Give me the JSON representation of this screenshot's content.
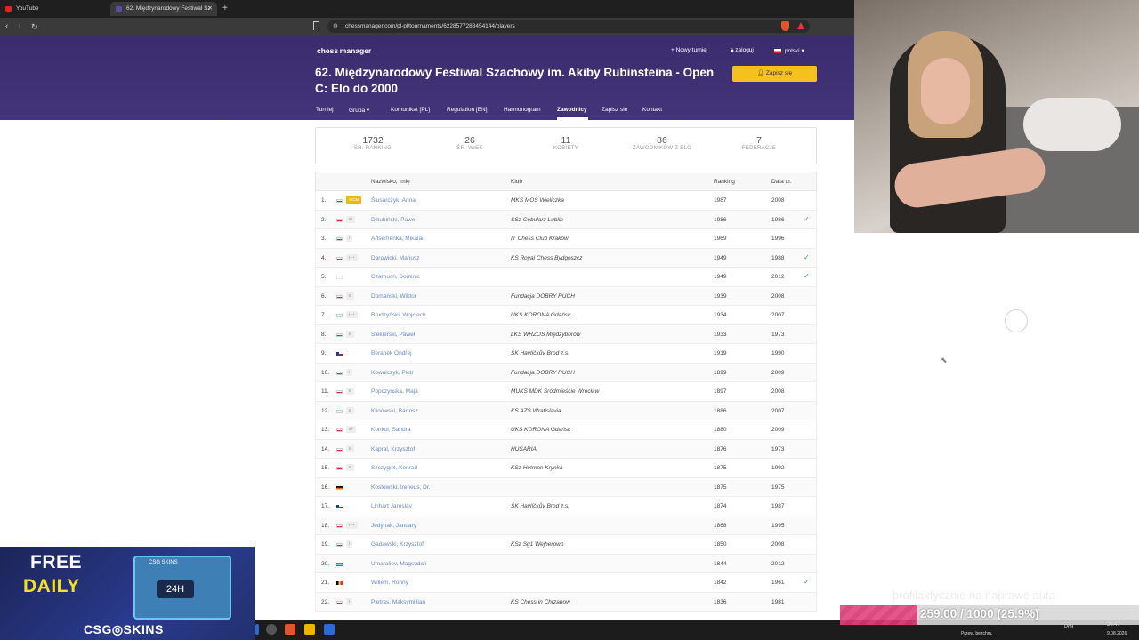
{
  "browser": {
    "tabs": [
      {
        "title": "YouTube",
        "active": false
      },
      {
        "title": "62. Międzynarodowy Festiwal Sz",
        "active": true
      }
    ],
    "url": "chessmanager.com/pl-pl/tournaments/6228577288454144/players"
  },
  "site": {
    "logo": "chess manager",
    "new_tournament": "+ Nowy turniej",
    "login": "zaloguj",
    "language": "polski",
    "title": "62. Międzynarodowy Festiwal Szachowy im. Akiby Rubinsteina - Open C: Elo do 2000",
    "join_button": "Zapisz się",
    "menu": [
      "Turniej",
      "Grupa",
      "Komunikat [PL]",
      "Regulation [EN]",
      "Harmonogram",
      "Zawodnicy",
      "Zapisz się",
      "Kontakt"
    ],
    "active_menu": "Zawodnicy"
  },
  "stats": [
    {
      "value": "1732",
      "label": "ŚR. RANKING"
    },
    {
      "value": "26",
      "label": "ŚR. WIEK"
    },
    {
      "value": "11",
      "label": "KOBIETY"
    },
    {
      "value": "86",
      "label": "ZAWODNIKÓW Z ELO"
    },
    {
      "value": "7",
      "label": "FEDERACJE"
    }
  ],
  "table": {
    "headers": {
      "name": "Nazwisko, Imię",
      "club": "Klub",
      "ranking": "Ranking",
      "year": "Data ur."
    },
    "rows": [
      {
        "no": "1.",
        "flag": "pl",
        "title": "WCM",
        "name": "Ślusarczyk, Anna",
        "club": "MKS MOS Wieliczka",
        "ranking": "1987",
        "year": "2008",
        "check": false
      },
      {
        "no": "2.",
        "flag": "pl",
        "title": "III",
        "name": "Dziubiński, Paweł",
        "club": "SSz Cebularz Lublin",
        "ranking": "1986",
        "year": "1986",
        "check": true
      },
      {
        "no": "3.",
        "flag": "pl",
        "title": "I",
        "name": "Artsemenka, Mikalai",
        "club": "IT Chess Club Kraków",
        "ranking": "1969",
        "year": "1996",
        "check": false
      },
      {
        "no": "4.",
        "flag": "pl",
        "title": "I++",
        "name": "Darowicki, Mariusz",
        "club": "KS Royal Chess Bydgoszcz",
        "ranking": "1949",
        "year": "1988",
        "check": true
      },
      {
        "no": "5.",
        "flag": "en",
        "title": "",
        "name": "Czarnuch, Dominic",
        "club": "",
        "ranking": "1949",
        "year": "2012",
        "check": true
      },
      {
        "no": "6.",
        "flag": "pl",
        "title": "II",
        "name": "Domański, Wiktor",
        "club": "Fundacja DOBRY RUCH",
        "ranking": "1939",
        "year": "2008",
        "check": false
      },
      {
        "no": "7.",
        "flag": "pl",
        "title": "I++",
        "name": "Brudzyński, Wojciech",
        "club": "UKS KORONA Gdańsk",
        "ranking": "1934",
        "year": "2007",
        "check": false
      },
      {
        "no": "8.",
        "flag": "pl",
        "title": "II",
        "name": "Siekierski, Paweł",
        "club": "LKS WRZOS Międzyborów",
        "ranking": "1933",
        "year": "1973",
        "check": false
      },
      {
        "no": "9.",
        "flag": "cz",
        "title": "",
        "name": "Beranek Ondřej",
        "club": "ŠK Havlíčkův Brod z.s.",
        "ranking": "1919",
        "year": "1990",
        "check": false
      },
      {
        "no": "10.",
        "flag": "pl",
        "title": "I",
        "name": "Kowalczyk, Piotr",
        "club": "Fundacja DOBRY RUCH",
        "ranking": "1899",
        "year": "2009",
        "check": false
      },
      {
        "no": "11.",
        "flag": "pl",
        "title": "II",
        "name": "Popczyńska, Maja",
        "club": "MUKS MDK Śródmieście Wrocław",
        "ranking": "1897",
        "year": "2008",
        "check": false
      },
      {
        "no": "12.",
        "flag": "pl",
        "title": "II",
        "name": "Klinowski, Bartosz",
        "club": "KS AZS Wratislavia",
        "ranking": "1886",
        "year": "2007",
        "check": false
      },
      {
        "no": "13.",
        "flag": "pl",
        "title": "II+",
        "name": "Konkol, Sandra",
        "club": "UKS KORONA Gdańsk",
        "ranking": "1880",
        "year": "2009",
        "check": false
      },
      {
        "no": "14.",
        "flag": "pl",
        "title": "II",
        "name": "Kapral, Krzysztof",
        "club": "HUSARIA",
        "ranking": "1876",
        "year": "1973",
        "check": false
      },
      {
        "no": "15.",
        "flag": "pl",
        "title": "II",
        "name": "Szczygieł, Konrad",
        "club": "KSz Hetman Krynka",
        "ranking": "1875",
        "year": "1992",
        "check": false
      },
      {
        "no": "16.",
        "flag": "de",
        "title": "",
        "name": "Kostowski, Ireneus, Dr.",
        "club": "",
        "ranking": "1875",
        "year": "1975",
        "check": false
      },
      {
        "no": "17.",
        "flag": "cz",
        "title": "",
        "name": "Linhart Jaroslav",
        "club": "ŠK Havlíčkův Brod z.s.",
        "ranking": "1874",
        "year": "1987",
        "check": false
      },
      {
        "no": "18.",
        "flag": "pl",
        "title": "I++",
        "name": "Jedynak, January",
        "club": "",
        "ranking": "1868",
        "year": "1995",
        "check": false
      },
      {
        "no": "19.",
        "flag": "pl",
        "title": "I",
        "name": "Gadawski, Krzysztof",
        "club": "KSz Sg1 Wejherowo",
        "ranking": "1850",
        "year": "2008",
        "check": false
      },
      {
        "no": "20.",
        "flag": "uz",
        "title": "",
        "name": "Umaraliev, Magsudali",
        "club": "",
        "ranking": "1844",
        "year": "2012",
        "check": false
      },
      {
        "no": "21.",
        "flag": "be",
        "title": "",
        "name": "Willem, Ronny",
        "club": "",
        "ranking": "1842",
        "year": "1961",
        "check": true
      },
      {
        "no": "22.",
        "flag": "pl",
        "title": "I",
        "name": "Pietras, Maksymillian",
        "club": "KS Chess in Chrzanow",
        "ranking": "1836",
        "year": "1981",
        "check": false
      }
    ]
  },
  "ad": {
    "line1": "FREE",
    "line2": "DAILY",
    "box_label": "24H",
    "box_brand": "CSG SKINS",
    "brand": "CSG◎SKINS"
  },
  "overlay": {
    "caption": "profilaktycznie na naprawe auta",
    "progress_text": "259.00 / 1000 (25.9%)",
    "progress_value": 0.259
  },
  "tray": {
    "lang": "POL",
    "time": "20:47",
    "date": "9.08.2026",
    "weather": "Przew. bezchm."
  },
  "colors": {
    "header": "#3f2f73",
    "accent": "#f6c11e",
    "link": "#6b8bc2",
    "check": "#2e9e44"
  }
}
